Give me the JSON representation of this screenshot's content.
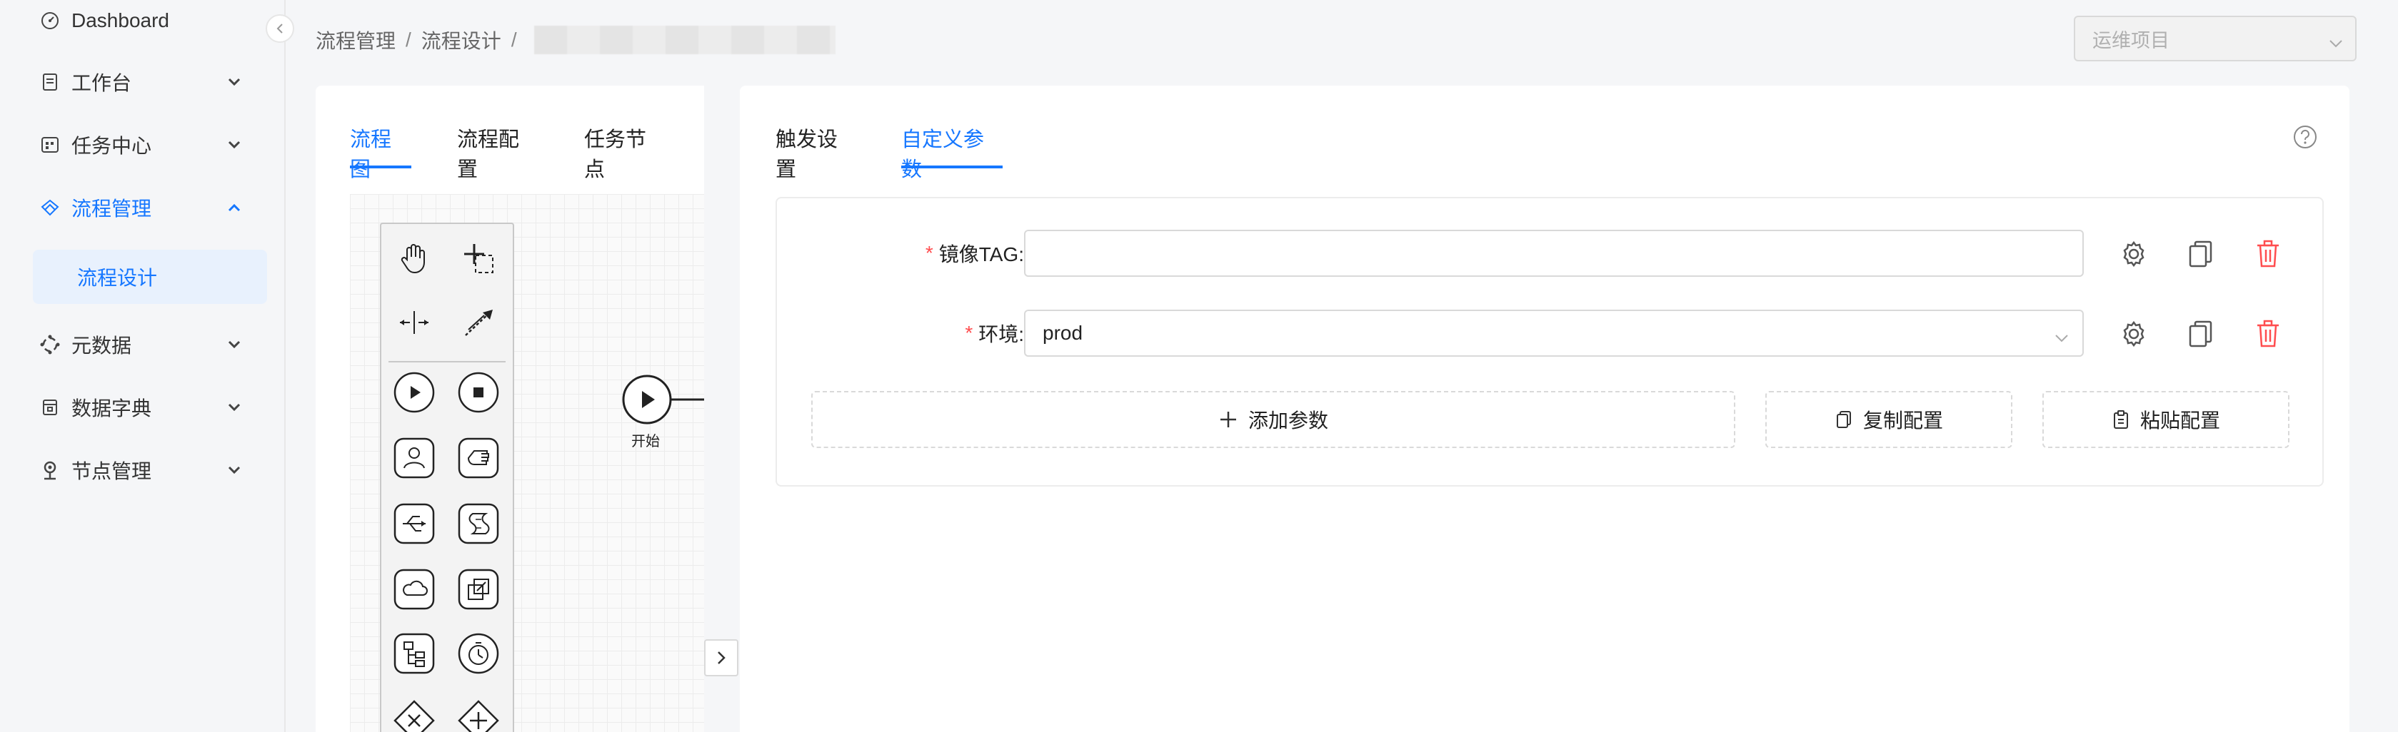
{
  "sidebar": {
    "items": [
      {
        "label": "Dashboard"
      },
      {
        "label": "工作台"
      },
      {
        "label": "任务中心"
      },
      {
        "label": "流程管理"
      },
      {
        "label": "元数据"
      },
      {
        "label": "数据字典"
      },
      {
        "label": "节点管理"
      }
    ],
    "sub_item": "流程设计"
  },
  "breadcrumb": {
    "items": [
      "流程管理",
      "流程设计"
    ],
    "separator": "/"
  },
  "project_select": {
    "value": "运维项目"
  },
  "left_panel": {
    "tabs": [
      {
        "label": "流程图",
        "active": true
      },
      {
        "label": "流程配置"
      },
      {
        "label": "任务节点"
      }
    ],
    "start_node_label": "开始"
  },
  "right_panel": {
    "tabs": [
      {
        "label": "触发设置"
      },
      {
        "label": "自定义参数",
        "active": true
      }
    ],
    "params": [
      {
        "label": "镜像TAG:",
        "value": "",
        "required": true
      },
      {
        "label": "环境:",
        "value": "prod",
        "required": true
      }
    ],
    "add_param_label": "添加参数",
    "copy_config_label": "复制配置",
    "paste_config_label": "粘贴配置"
  },
  "colors": {
    "accent": "#1677ff",
    "danger": "#ff4d4f",
    "background": "#f5f6f8"
  }
}
